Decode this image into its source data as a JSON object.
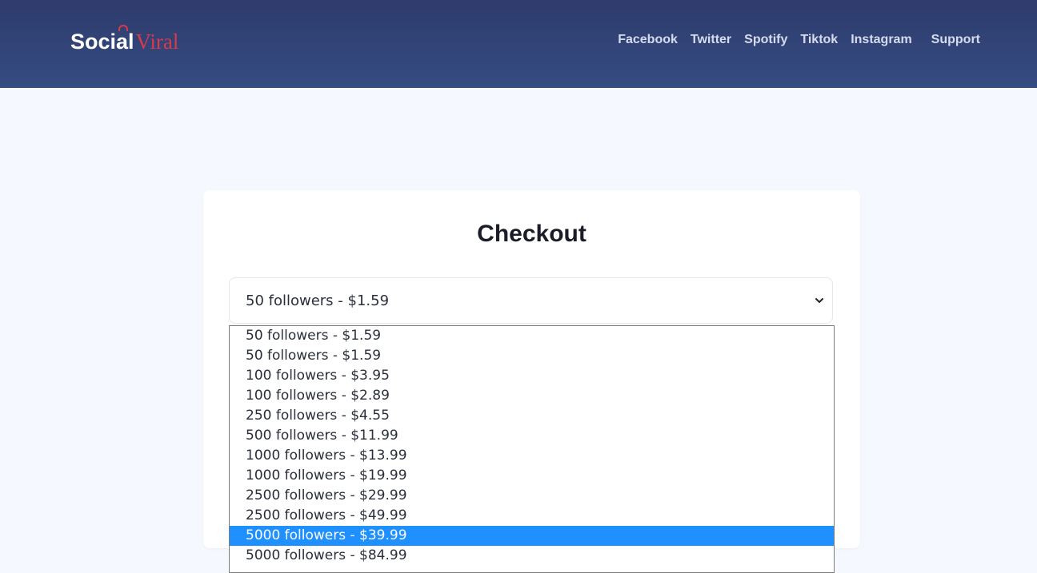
{
  "brand": {
    "name_part1": "Social",
    "name_part2": "Viral"
  },
  "nav": {
    "items": [
      "Facebook",
      "Twitter",
      "Spotify",
      "Tiktok",
      "Instagram",
      "Support"
    ]
  },
  "checkout": {
    "title": "Checkout",
    "selected_value": "50 followers - $1.59",
    "options": [
      "50 followers - $1.59",
      "50 followers - $1.59",
      "100 followers - $3.95",
      "100 followers - $2.89",
      "250 followers - $4.55",
      "500 followers - $11.99",
      "1000 followers - $13.99",
      "1000 followers - $19.99",
      "2500 followers - $29.99",
      "2500 followers - $49.99",
      "5000 followers - $39.99",
      "5000 followers - $84.99"
    ],
    "highlighted_index": 10
  },
  "colors": {
    "header": "#2e3b6c",
    "accent": "#d93a4c",
    "highlight": "#1e90ff"
  }
}
